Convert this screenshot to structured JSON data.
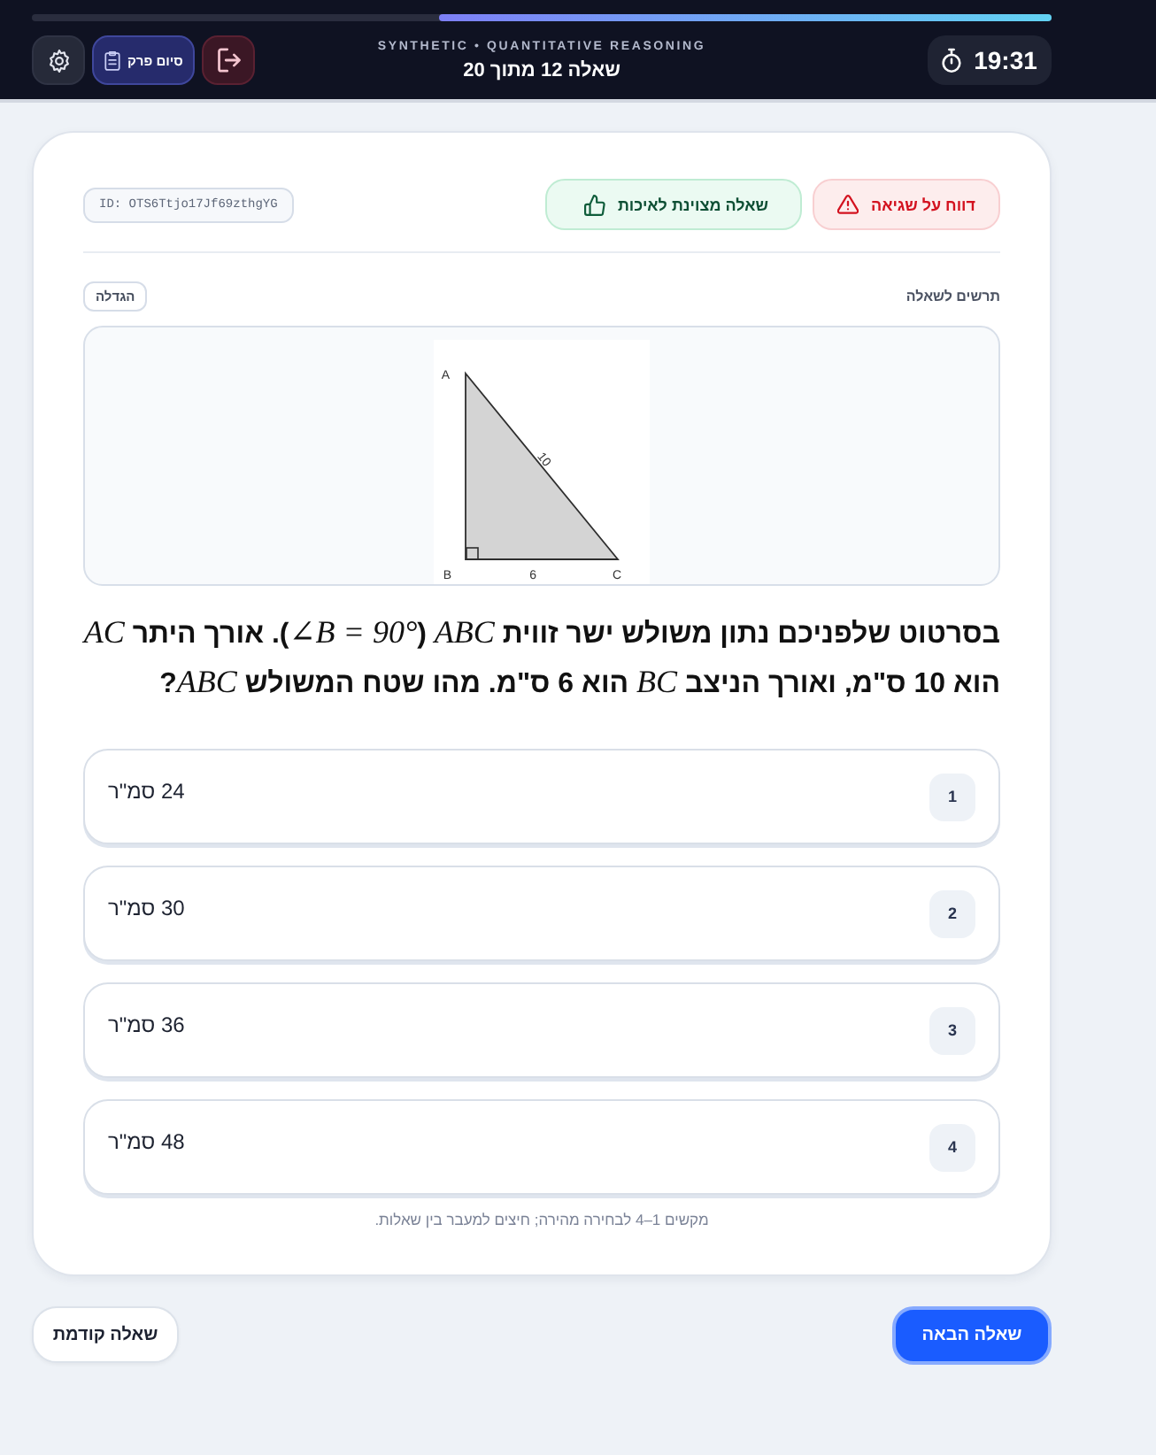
{
  "top_bar": {
    "progress": {
      "level": 0.6
    },
    "timer": "19:31",
    "subtitle": "SYNTHETIC • QUANTITATIVE REASONING",
    "title": "שאלה 12 מתוך 20",
    "buttons": [
      {
        "kind": "exit"
      },
      {
        "kind": "finish",
        "label": "סיום פרק"
      },
      {
        "kind": "settings"
      }
    ]
  },
  "question_card": {
    "actions": [
      {
        "kind": "report",
        "label": "דווח על שגיאה"
      },
      {
        "kind": "quality",
        "label": "שאלה מצוינת לאיכות"
      }
    ],
    "id": "ID: OTS6Ttjo17Jf69zthgYG",
    "diagram": {
      "title": "תרשים לשאלה",
      "zoom_button": "הגדלה",
      "vertices": [
        "A",
        "B",
        "C"
      ],
      "sides": [
        "10",
        "6"
      ]
    },
    "question": "בסרטוט שלפניכם נתון משולש ישר זווית *ABC* (*∠B = 90°*). אורך היתר *AC* הוא 10 ס\"מ, ואורך הניצב *BC* הוא 6 ס\"מ. מהו שטח המשולש *ABC*?",
    "options": [
      {
        "number": "1",
        "text": "24 סמ\"ר",
        "selected": false
      },
      {
        "number": "2",
        "text": "30 סמ\"ר",
        "selected": false
      },
      {
        "number": "3",
        "text": "36 סמ\"ר",
        "selected": false
      },
      {
        "number": "4",
        "text": "48 סמ\"ר",
        "selected": false
      }
    ],
    "hint": "מקשים 1–4 לבחירה מהירה; חיצים למעבר בין שאלות."
  },
  "navigation": {
    "next": "שאלה הבאה",
    "previous": "שאלה קודמת"
  }
}
